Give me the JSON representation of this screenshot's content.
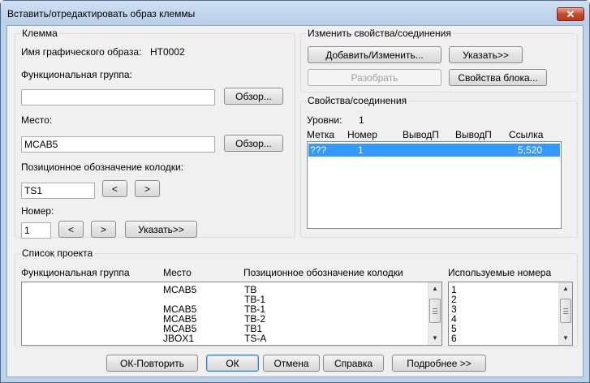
{
  "window": {
    "title": "Вставить/отредактировать образ клеммы",
    "close_label": "✕"
  },
  "terminal": {
    "group_title": "Клемма",
    "graphic_name_label": "Имя графического образа:",
    "graphic_name_value": "HT0002",
    "func_group_label": "Функциональная группа:",
    "func_group_value": "",
    "browse1_label": "Обзор...",
    "location_label": "Место:",
    "location_value": "MCAB5",
    "browse2_label": "Обзор...",
    "tag_label": "Позиционное обозначение колодки:",
    "tag_value": "TS1",
    "tag_prev": "<",
    "tag_next": ">",
    "number_label": "Номер:",
    "number_value": "1",
    "num_prev": "<",
    "num_next": ">",
    "pick_label": "Указать>>"
  },
  "modify": {
    "group_title": "Изменить свойства/соединения",
    "add_edit_label": "Добавить/Изменить...",
    "pick_label": "Указать>>",
    "explode_label": "Разобрать",
    "block_props_label": "Свойства блока..."
  },
  "props": {
    "group_title": "Свойства/соединения",
    "levels_label": "Уровни:",
    "levels_value": "1",
    "columns": [
      "Метка",
      "Номер",
      "ВыводП",
      "ВыводП",
      "Ссылка"
    ],
    "row": {
      "label": "???",
      "number": "1",
      "pin1": "",
      "pin2": "",
      "ref": "5;520"
    }
  },
  "project_list": {
    "group_title": "Список проекта",
    "columns": [
      "Функциональная группа",
      "Место",
      "Позиционное обозначение колодки"
    ],
    "rows": [
      {
        "group": "",
        "location": "MCAB5",
        "tag": "TB"
      },
      {
        "group": "",
        "location": "",
        "tag": "TB-1"
      },
      {
        "group": "",
        "location": "MCAB5",
        "tag": "TB-1"
      },
      {
        "group": "",
        "location": "MCAB5",
        "tag": "TB-2"
      },
      {
        "group": "",
        "location": "MCAB5",
        "tag": "TB1"
      },
      {
        "group": "",
        "location": "JBOX1",
        "tag": "TS-A"
      }
    ],
    "used_numbers_header": "Используемые номера",
    "used_numbers": [
      "1",
      "2",
      "3",
      "4",
      "5",
      "6"
    ]
  },
  "footer": {
    "ok_repeat_label": "ОК-Повторить",
    "ok_label": "ОК",
    "cancel_label": "Отмена",
    "help_label": "Справка",
    "details_label": "Подробнее >>"
  }
}
